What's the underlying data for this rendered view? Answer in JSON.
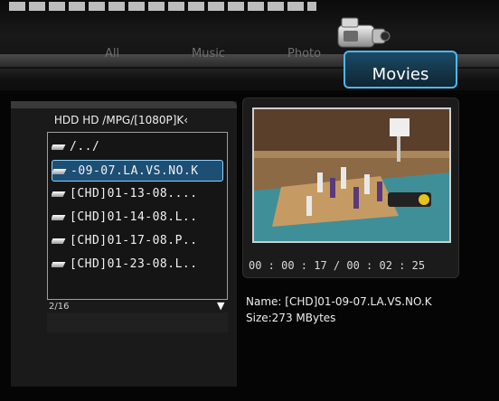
{
  "tabs": {
    "all": "All",
    "music": "Music",
    "photo": "Photo",
    "movies": "Movies"
  },
  "icons": {
    "camera": "camera-icon",
    "file": "file-icon",
    "scroll_down": "triangle-down-icon"
  },
  "file_browser": {
    "path": "HDD  HD /MPG/[1080P]K‹",
    "items": [
      {
        "label": "/../"
      },
      {
        "label": "-09-07.LA.VS.NO.K"
      },
      {
        "label": "[CHD]01-13-08...."
      },
      {
        "label": "[CHD]01-14-08.L.."
      },
      {
        "label": "[CHD]01-17-08.P.."
      },
      {
        "label": "[CHD]01-23-08.L.."
      }
    ],
    "selected_index": 1,
    "counter": "2/16",
    "scroll_arrow": "▼"
  },
  "preview": {
    "time": "00 : 00 : 17 / 00 : 02 : 25"
  },
  "details": {
    "name": "Name: [CHD]01-09-07.LA.VS.NO.K",
    "size": "Size:273 MBytes"
  },
  "colors": {
    "accent": "#4fb8ea",
    "selection": "#1d4f74"
  }
}
